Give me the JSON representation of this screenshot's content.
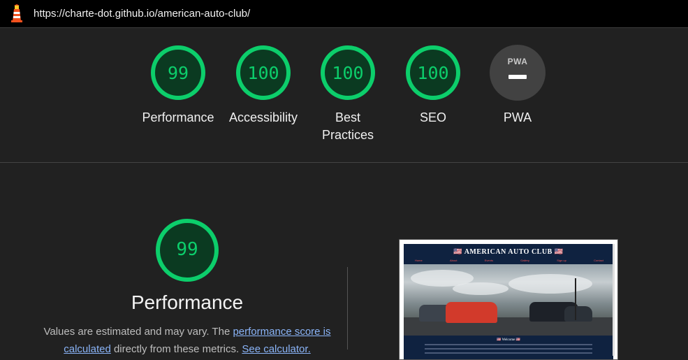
{
  "browser": {
    "url": "https://charte-dot.github.io/american-auto-club/"
  },
  "scores": [
    {
      "label": "Performance",
      "value": "99"
    },
    {
      "label": "Accessibility",
      "value": "100"
    },
    {
      "label": "Best Practices",
      "value": "100"
    },
    {
      "label": "SEO",
      "value": "100"
    },
    {
      "label": "PWA",
      "value": ""
    }
  ],
  "pwa": {
    "badge_text": "PWA"
  },
  "performance": {
    "score": "99",
    "title": "Performance",
    "desc_prefix": "Values are estimated and may vary. The ",
    "link_score": "performance score is calculated",
    "desc_middle": " directly from these metrics. ",
    "link_calculator": "See calculator."
  },
  "screenshot": {
    "site_title": "🇺🇸 AMERICAN AUTO CLUB 🇺🇸",
    "nav": [
      "Home",
      "About",
      "Events",
      "Gallery",
      "Sign up",
      "Contact"
    ],
    "welcome": "🇺🇸 Welcome 🇺🇸"
  },
  "colors": {
    "pass": "#0cce6b",
    "pass_bg": "#0b3a21",
    "link": "#8ab4f8",
    "background": "#212121"
  }
}
